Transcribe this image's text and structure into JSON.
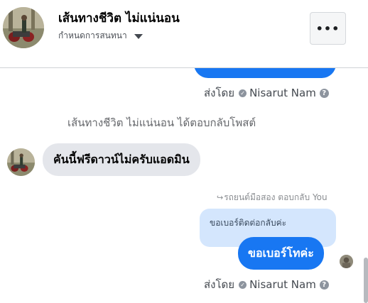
{
  "header": {
    "title": "เส้นทางชีวิต ไม่แน่นอน",
    "subtitle": "กำหนดการสนทนา",
    "menu_label": "•••"
  },
  "messages": {
    "sent_by_1": {
      "prefix": "ส่งโดย",
      "name": "Nisarut Nam"
    },
    "notice": "เส้นทางชีวิต ไม่แน่นอน ได้ตอบกลับโพสต์",
    "incoming": "คันนี้ฟรีดาวน์ไม่ครับแอดมิน",
    "reply_label": "รถยนต์มือสอง ตอบกลับ You",
    "quoted_text": "ขอเบอร์ติดต่อกลับค่ะ",
    "outgoing": "ขอเบอร์โทค่ะ",
    "sent_by_2": {
      "prefix": "ส่งโดย",
      "name": "Nisarut Nam"
    }
  },
  "icons": {
    "check": "✓",
    "help": "?",
    "reply": "↪"
  },
  "colors": {
    "accent": "#1877f2",
    "incoming_bubble": "#e4e6eb",
    "quoted_bubble": "#d4e6fd"
  }
}
